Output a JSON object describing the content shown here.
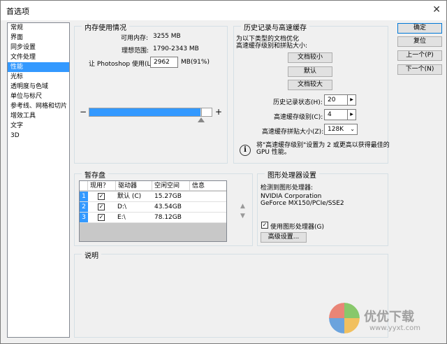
{
  "window": {
    "title": "首选项",
    "close_glyph": "✕"
  },
  "categories": [
    {
      "label": "常规"
    },
    {
      "label": "界面"
    },
    {
      "label": "同步设置"
    },
    {
      "label": "文件处理"
    },
    {
      "label": "性能",
      "selected": true
    },
    {
      "label": "光标"
    },
    {
      "label": "透明度与色域"
    },
    {
      "label": "单位与标尺"
    },
    {
      "label": "参考线、网格和切片"
    },
    {
      "label": "增效工具"
    },
    {
      "label": "文字"
    },
    {
      "label": "3D"
    }
  ],
  "memory": {
    "title": "内存使用情况",
    "available_label": "可用内存:",
    "available_value": "3255 MB",
    "ideal_label": "理想范围:",
    "ideal_value": "1790-2343 MB",
    "let_label": "让 Photoshop 使用(L):",
    "let_value": "2962",
    "let_unit": "MB(91%)",
    "minus": "−",
    "plus": "+",
    "usage_fraction": 0.91
  },
  "history": {
    "title": "历史记录与高速缓存",
    "desc_line1": "为以下类型的文档优化",
    "desc_line2": "高速缓存级别和拼贴大小:",
    "btn_small": "文档较小",
    "btn_default": "默认",
    "btn_large": "文档较大",
    "states_label": "历史记录状态(H):",
    "states_value": "20",
    "levels_label": "高速缓存级别(C):",
    "levels_value": "4",
    "tile_label": "高速缓存拼贴大小(Z):",
    "tile_value": "128K",
    "info_text_1": "将\"高速缓存级别\"设置为 2 或更高以获得最佳的",
    "info_text_2": "GPU 性能。"
  },
  "scratch": {
    "title": "暂存盘",
    "headers": {
      "active": "现用？",
      "drive": "驱动器",
      "free": "空闲空间",
      "info": "信息"
    },
    "rows": [
      {
        "num": "1",
        "checked": "✓",
        "drive": "默认 (C)",
        "free": "15.27GB"
      },
      {
        "num": "2",
        "checked": "✓",
        "drive": "D:\\",
        "free": "43.54GB"
      },
      {
        "num": "3",
        "checked": "✓",
        "drive": "E:\\",
        "free": "78.12GB"
      }
    ],
    "up": "▲",
    "down": "▼"
  },
  "gpu": {
    "title": "图形处理器设置",
    "detected_label": "检测到图形处理器:",
    "vendor": "NVIDIA Corporation",
    "model": "GeForce MX150/PCIe/SSE2",
    "use_label": "使用图形处理器(G)",
    "advanced_btn": "高级设置..."
  },
  "description": {
    "title": "说明"
  },
  "buttons": {
    "ok": "确定",
    "reset": "复位",
    "prev": "上一个(P)",
    "next": "下一个(N)"
  },
  "watermark": {
    "text": "优优下载",
    "url": "www.yyxt.com"
  },
  "colors": {
    "accent": "#3399ff"
  }
}
